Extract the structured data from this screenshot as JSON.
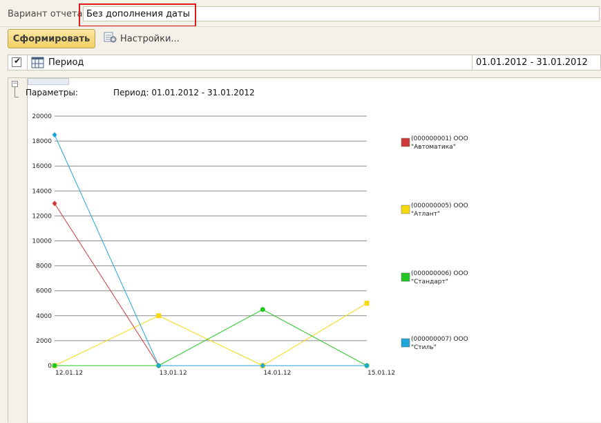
{
  "header": {
    "variant_label": "Вариант отчета:",
    "variant_value": "Без дополнения даты",
    "highlight_color": "#e0191b"
  },
  "toolbar": {
    "generate_label": "Сформировать",
    "settings_label": "Настройки..."
  },
  "params": {
    "checked": true,
    "name": "Период",
    "value": "01.01.2012 - 31.01.2012"
  },
  "report": {
    "param_label": "Параметры:",
    "param_text": "Период: 01.01.2012 - 31.01.2012"
  },
  "chart_data": {
    "type": "line",
    "categories": [
      "12.01.12",
      "13.01.12",
      "14.01.12",
      "15.01.12"
    ],
    "ylim": [
      0,
      20000
    ],
    "yticks": [
      0,
      2000,
      4000,
      6000,
      8000,
      10000,
      12000,
      14000,
      16000,
      18000,
      20000
    ],
    "grid": true,
    "legend_position": "right",
    "series": [
      {
        "name": "(000000001) ООО \"Автоматика\"",
        "color": "#d03a3a",
        "marker": "diamond",
        "values": [
          13000,
          0,
          0,
          0
        ]
      },
      {
        "name": "(000000005) ООО \"Атлант\"",
        "color": "#f5d90a",
        "marker": "square",
        "values": [
          0,
          4000,
          0,
          5000
        ]
      },
      {
        "name": "(000000006) ООО \"Стандарт\"",
        "color": "#22c722",
        "marker": "circle",
        "values": [
          0,
          0,
          4500,
          0
        ]
      },
      {
        "name": "(000000007) ООО \"Стиль\"",
        "color": "#1fa5d8",
        "marker": "diamond",
        "values": [
          18500,
          0,
          0,
          0
        ]
      }
    ]
  }
}
